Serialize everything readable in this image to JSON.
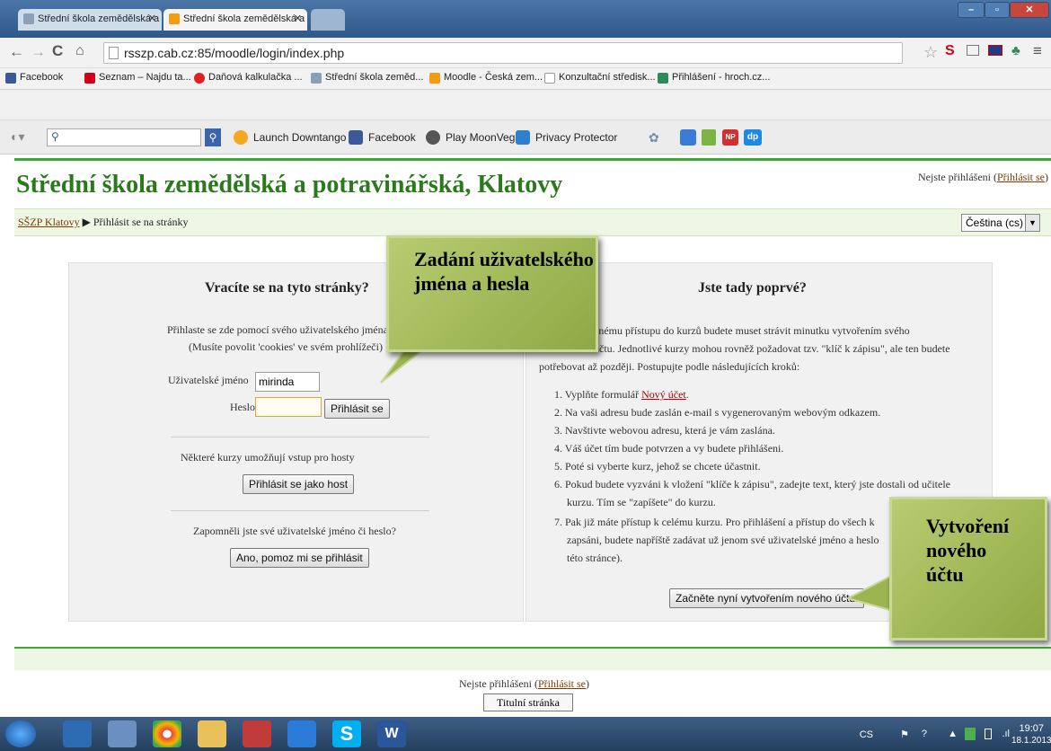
{
  "browser": {
    "tabs": [
      {
        "label": "Střední škola zemědělská a"
      },
      {
        "label": "Střední škola zemědělská a"
      }
    ],
    "url": "rsszp.cab.cz:85/moodle/login/index.php",
    "bookmarks": [
      {
        "label": "Facebook",
        "color": "#3b5998"
      },
      {
        "label": "Seznam – Najdu ta...",
        "color": "#d0021b"
      },
      {
        "label": "Daňová kalkulačka ...",
        "color": "#e02020"
      },
      {
        "label": "Střední škola zeměd...",
        "color": "#8aa0b8"
      },
      {
        "label": "Moodle - Česká zem...",
        "color": "#f39c12"
      },
      {
        "label": "Konzultační středisk...",
        "color": "#bbbbbb"
      },
      {
        "label": "Přihlášení - hroch.cz...",
        "color": "#2e8b57"
      }
    ],
    "toolbar_items": [
      {
        "label": "Launch Downtango",
        "color": "#f5a623"
      },
      {
        "label": "Facebook",
        "color": "#3b5998"
      },
      {
        "label": "Play MoonVegas",
        "color": "#555555"
      },
      {
        "label": "Privacy Protector",
        "color": "#2f7fd1"
      }
    ]
  },
  "moodle": {
    "site_title": "Střední škola zemědělská a potravinářská, Klatovy",
    "login_info": {
      "prefix": "Nejste přihlášeni (",
      "link": "Přihlásit se",
      "suffix": ")"
    },
    "breadcrumb": {
      "home": "SŠZP Klatovy",
      "separator": "▶",
      "current": "Přihlásit se na stránky"
    },
    "language": "Čeština (cs)",
    "left_panel": {
      "heading": "Vracíte se na tyto stránky?",
      "line1": "Přihlaste se zde pomocí svého uživatelského jména",
      "line2": "(Musíte povolit 'cookies' ve svém prohlížeči)",
      "username_label": "Uživatelské jméno",
      "username_value": "mirinda",
      "password_label": "Heslo",
      "login_button": "Přihlásit se",
      "guest_text": "Některé kurzy umožňují vstup pro hosty",
      "guest_button": "Přihlásit se jako host",
      "forgot_text": "Zapomněli jste své uživatelské jméno či heslo?",
      "forgot_button": "Ano, pomoz mi se přihlásit"
    },
    "right_panel": {
      "heading": "Jste tady poprvé?",
      "intro1": "plnému přístupu do kurzů budete muset strávit minutku vytvořením svého",
      "intro2": "o účtu. Jednotlivé kurzy mohou rovněž požadovat tzv. \"klíč k zápisu\", ale ten budete",
      "intro3": "potřebovat až později. Postupujte podle následujících kroků:",
      "step1_prefix": "1. Vyplňte formulář ",
      "step1_link": "Nový účet",
      "step1_suffix": ".",
      "step2": "2. Na vaši adresu bude zaslán e-mail s vygenerovaným webovým odkazem.",
      "step3": "3. Navštivte webovou adresu, která je vám zaslána.",
      "step4": "4. Váš účet tím bude potvrzen a vy budete přihlášeni.",
      "step5": "5. Poté si vyberte kurz, jehož se chcete účastnit.",
      "step6a": "6. Pokud budete vyzváni k vložení \"klíče k zápisu\", zadejte text, který jste dostali od učitele",
      "step6b": "kurzu. Tím se \"zapíšete\" do kurzu.",
      "step7a": "7. Pak již máte přístup k celému kurzu. Pro přihlášení a přístup do všech k",
      "step7b": "zapsáni, budete napříště zadávat už jenom své uživatelské jméno a heslo",
      "step7c": "této stránce).",
      "create_button": "Začněte nyní vytvořením nového účtu!"
    },
    "home_button": "Titulní stránka"
  },
  "callouts": {
    "left": "Zadání uživatelského jména a hesla",
    "right": "Vytvoření nového účtu"
  },
  "taskbar": {
    "lang": "CS",
    "time": "19:07",
    "date": "18.1.2013"
  }
}
